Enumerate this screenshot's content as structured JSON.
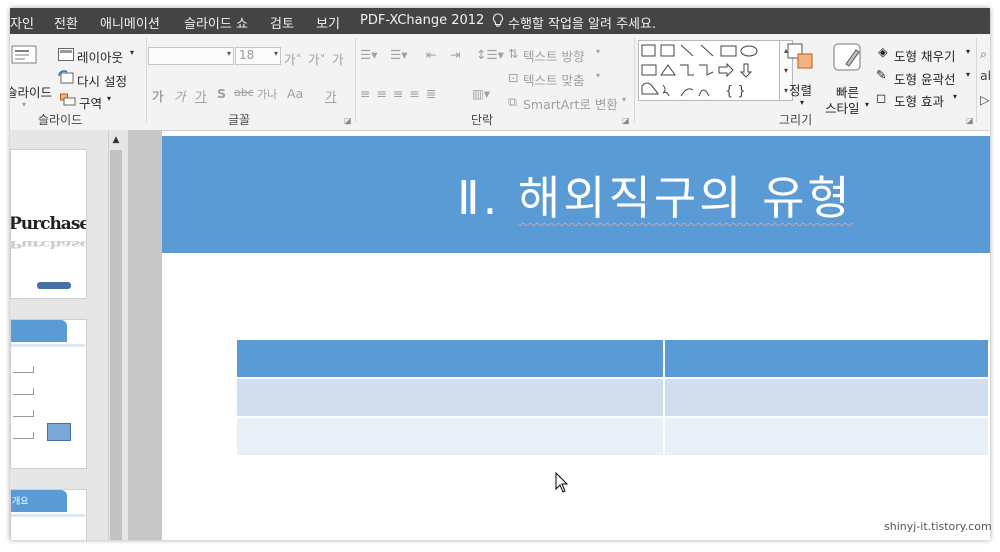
{
  "menu": {
    "tabs": [
      "자인",
      "전환",
      "애니메이션",
      "슬라이드 쇼",
      "검토",
      "보기",
      "PDF-XChange 2012"
    ],
    "tell_me": "수행할 작업을 알려 주세요."
  },
  "ribbon": {
    "slides": {
      "new_slide": "슬라이드",
      "layout": "레이아웃",
      "reset": "다시 설정",
      "section": "구역",
      "group_label": "슬라이드"
    },
    "font": {
      "font_size": "18",
      "bold": "가",
      "italic": "가",
      "underline": "가",
      "shadow": "S",
      "spacing": "가나",
      "change_case": "Aa",
      "color": "가",
      "grow": "가˄",
      "shrink": "가˅",
      "clear": "가",
      "group_label": "글꼴"
    },
    "paragraph": {
      "text_direction": "텍스트 방향",
      "align_text": "텍스트 맞춤",
      "smartart": "SmartArt로 변환",
      "group_label": "단락"
    },
    "drawing": {
      "arrange": "정렬",
      "quick_styles_1": "빠른",
      "quick_styles_2": "스타일",
      "shape_fill": "도형 채우기",
      "shape_outline": "도형 윤곽선",
      "shape_effects": "도형 효과",
      "group_label": "그리기"
    }
  },
  "thumbnails": {
    "t1_text": "Purchase",
    "t3_text": "개요"
  },
  "slide": {
    "roman": "Ⅱ.",
    "title": "해외직구의 유형"
  },
  "table": {
    "columns": 2,
    "rows": 3
  },
  "watermark": "shinyj-it.tistory.com",
  "colors": {
    "menubar": "#444444",
    "ribbon": "#f3f3f3",
    "accent": "#5b9bd5",
    "row_light": "#d0deee",
    "row_lighter": "#e9eff7"
  }
}
